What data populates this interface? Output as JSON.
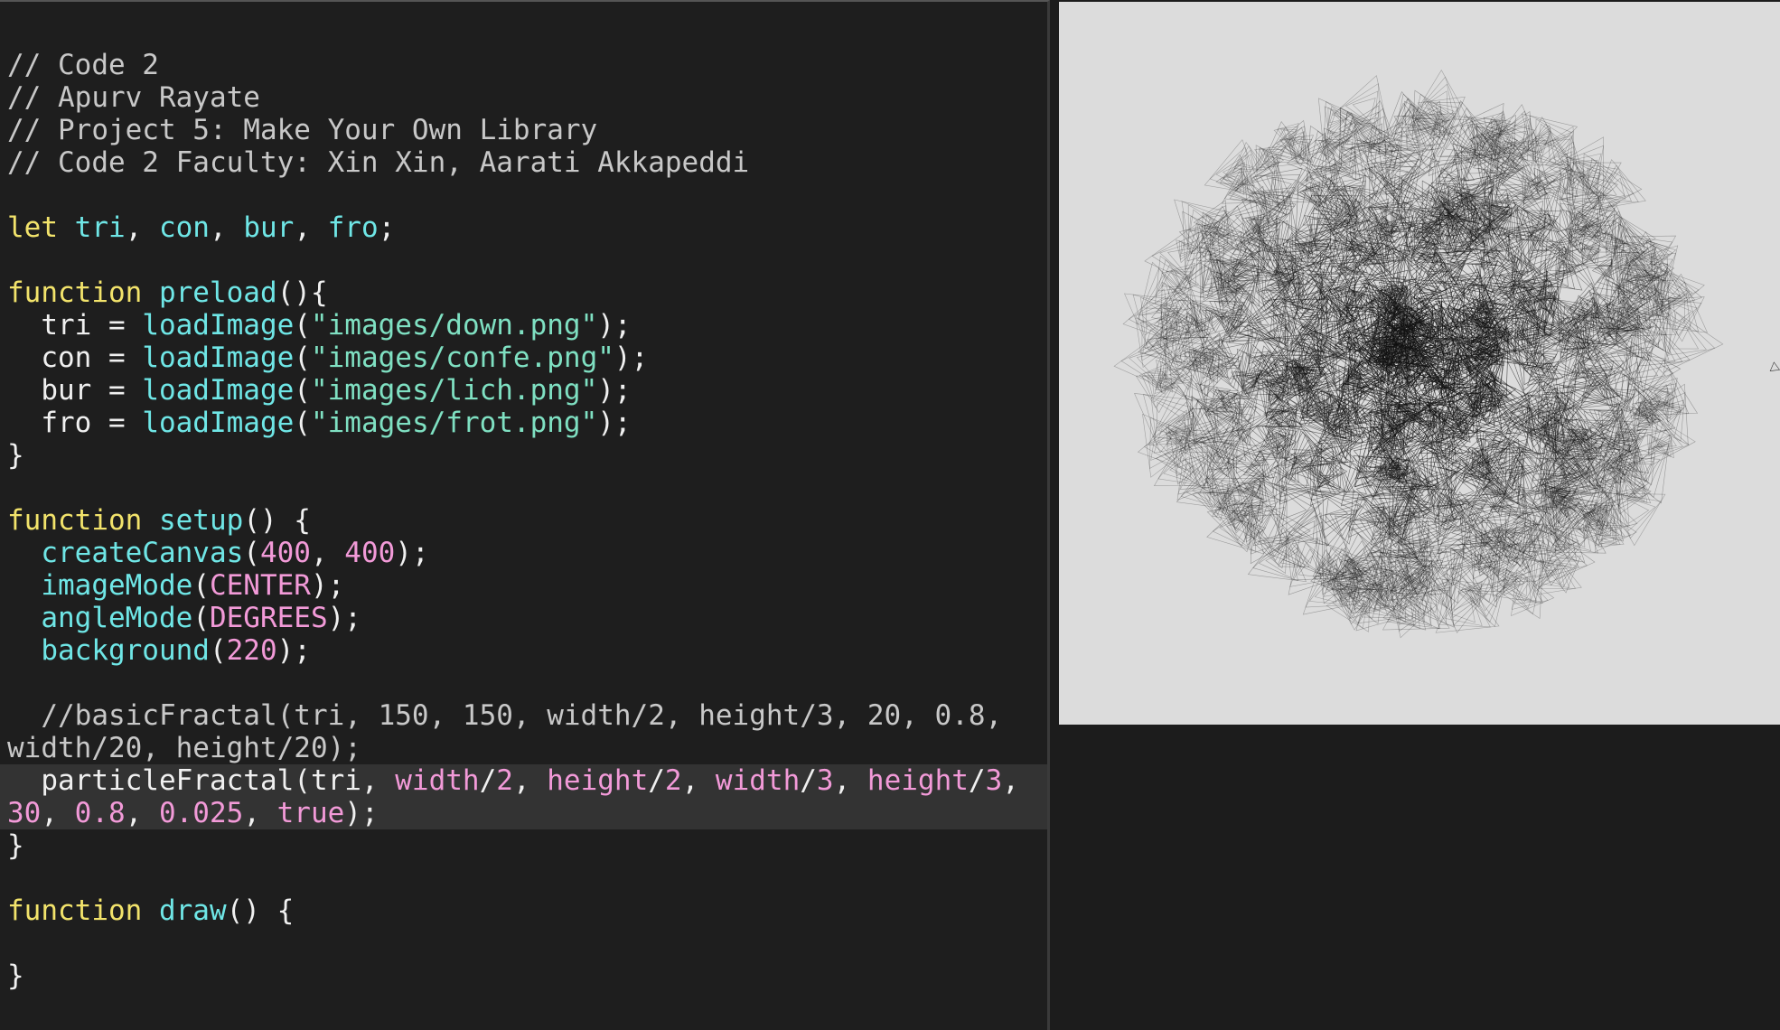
{
  "editor": {
    "lines": [
      {
        "tokens": [
          {
            "t": "// Code 2",
            "c": "cm"
          }
        ]
      },
      {
        "tokens": [
          {
            "t": "// Apurv Rayate",
            "c": "cm"
          }
        ]
      },
      {
        "tokens": [
          {
            "t": "// Project 5: Make Your Own Library",
            "c": "cm"
          }
        ]
      },
      {
        "tokens": [
          {
            "t": "// Code 2 Faculty: Xin Xin, Aarati Akkapeddi",
            "c": "cm"
          }
        ]
      },
      {
        "tokens": []
      },
      {
        "tokens": [
          {
            "t": "let ",
            "c": "kw"
          },
          {
            "t": "tri",
            "c": "fn"
          },
          {
            "t": ", ",
            "c": "pl"
          },
          {
            "t": "con",
            "c": "fn"
          },
          {
            "t": ", ",
            "c": "pl"
          },
          {
            "t": "bur",
            "c": "fn"
          },
          {
            "t": ", ",
            "c": "pl"
          },
          {
            "t": "fro",
            "c": "fn"
          },
          {
            "t": ";",
            "c": "pl"
          }
        ]
      },
      {
        "tokens": []
      },
      {
        "tokens": [
          {
            "t": "function ",
            "c": "kw"
          },
          {
            "t": "preload",
            "c": "fn"
          },
          {
            "t": "(){",
            "c": "pl"
          }
        ]
      },
      {
        "tokens": [
          {
            "t": "  tri = ",
            "c": "pl"
          },
          {
            "t": "loadImage",
            "c": "fn"
          },
          {
            "t": "(",
            "c": "pl"
          },
          {
            "t": "\"images/down.png\"",
            "c": "str"
          },
          {
            "t": ");",
            "c": "pl"
          }
        ]
      },
      {
        "tokens": [
          {
            "t": "  con = ",
            "c": "pl"
          },
          {
            "t": "loadImage",
            "c": "fn"
          },
          {
            "t": "(",
            "c": "pl"
          },
          {
            "t": "\"images/confe.png\"",
            "c": "str"
          },
          {
            "t": ");",
            "c": "pl"
          }
        ]
      },
      {
        "tokens": [
          {
            "t": "  bur = ",
            "c": "pl"
          },
          {
            "t": "loadImage",
            "c": "fn"
          },
          {
            "t": "(",
            "c": "pl"
          },
          {
            "t": "\"images/lich.png\"",
            "c": "str"
          },
          {
            "t": ");",
            "c": "pl"
          }
        ]
      },
      {
        "tokens": [
          {
            "t": "  fro = ",
            "c": "pl"
          },
          {
            "t": "loadImage",
            "c": "fn"
          },
          {
            "t": "(",
            "c": "pl"
          },
          {
            "t": "\"images/frot.png\"",
            "c": "str"
          },
          {
            "t": ");",
            "c": "pl"
          }
        ]
      },
      {
        "tokens": [
          {
            "t": "}",
            "c": "pl"
          }
        ]
      },
      {
        "tokens": []
      },
      {
        "tokens": [
          {
            "t": "function ",
            "c": "kw"
          },
          {
            "t": "setup",
            "c": "fn"
          },
          {
            "t": "() {",
            "c": "pl"
          }
        ]
      },
      {
        "tokens": [
          {
            "t": "  ",
            "c": "pl"
          },
          {
            "t": "createCanvas",
            "c": "fn"
          },
          {
            "t": "(",
            "c": "pl"
          },
          {
            "t": "400",
            "c": "num"
          },
          {
            "t": ", ",
            "c": "pl"
          },
          {
            "t": "400",
            "c": "num"
          },
          {
            "t": ");",
            "c": "pl"
          }
        ]
      },
      {
        "tokens": [
          {
            "t": "  ",
            "c": "pl"
          },
          {
            "t": "imageMode",
            "c": "fn"
          },
          {
            "t": "(",
            "c": "pl"
          },
          {
            "t": "CENTER",
            "c": "num"
          },
          {
            "t": ");",
            "c": "pl"
          }
        ]
      },
      {
        "tokens": [
          {
            "t": "  ",
            "c": "pl"
          },
          {
            "t": "angleMode",
            "c": "fn"
          },
          {
            "t": "(",
            "c": "pl"
          },
          {
            "t": "DEGREES",
            "c": "num"
          },
          {
            "t": ");",
            "c": "pl"
          }
        ]
      },
      {
        "tokens": [
          {
            "t": "  ",
            "c": "pl"
          },
          {
            "t": "background",
            "c": "fn"
          },
          {
            "t": "(",
            "c": "pl"
          },
          {
            "t": "220",
            "c": "num"
          },
          {
            "t": ");",
            "c": "pl"
          }
        ]
      },
      {
        "tokens": []
      },
      {
        "tokens": [
          {
            "t": "  //basicFractal(tri, 150, 150, width/2, height/3, 20, 0.8,",
            "c": "cm"
          }
        ]
      },
      {
        "tokens": [
          {
            "t": "width/20, height/20);",
            "c": "cm"
          }
        ]
      },
      {
        "hl": true,
        "tokens": [
          {
            "t": "  particleFractal(tri, ",
            "c": "pl"
          },
          {
            "t": "width",
            "c": "num"
          },
          {
            "t": "/",
            "c": "pl"
          },
          {
            "t": "2",
            "c": "num"
          },
          {
            "t": ", ",
            "c": "pl"
          },
          {
            "t": "height",
            "c": "num"
          },
          {
            "t": "/",
            "c": "pl"
          },
          {
            "t": "2",
            "c": "num"
          },
          {
            "t": ", ",
            "c": "pl"
          },
          {
            "t": "width",
            "c": "num"
          },
          {
            "t": "/",
            "c": "pl"
          },
          {
            "t": "3",
            "c": "num"
          },
          {
            "t": ", ",
            "c": "pl"
          },
          {
            "t": "height",
            "c": "num"
          },
          {
            "t": "/",
            "c": "pl"
          },
          {
            "t": "3",
            "c": "num"
          },
          {
            "t": ",",
            "c": "pl"
          }
        ]
      },
      {
        "hl": true,
        "tokens": [
          {
            "t": "30",
            "c": "num"
          },
          {
            "t": ", ",
            "c": "pl"
          },
          {
            "t": "0.8",
            "c": "num"
          },
          {
            "t": ", ",
            "c": "pl"
          },
          {
            "t": "0.025",
            "c": "num"
          },
          {
            "t": ", ",
            "c": "pl"
          },
          {
            "t": "true",
            "c": "num"
          },
          {
            "t": ");",
            "c": "pl"
          }
        ]
      },
      {
        "tokens": [
          {
            "t": "}",
            "c": "pl"
          }
        ]
      },
      {
        "tokens": []
      },
      {
        "tokens": [
          {
            "t": "function ",
            "c": "kw"
          },
          {
            "t": "draw",
            "c": "fn"
          },
          {
            "t": "() {",
            "c": "pl"
          }
        ]
      },
      {
        "tokens": []
      },
      {
        "tokens": [
          {
            "t": "}",
            "c": "pl"
          }
        ]
      }
    ]
  },
  "preview": {
    "background": "#dcdcdc",
    "ink": "#111111"
  }
}
